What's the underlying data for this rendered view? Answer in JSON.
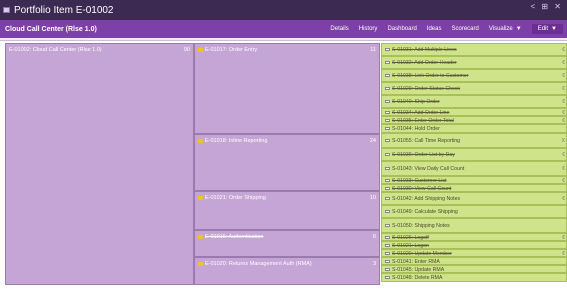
{
  "window": {
    "title": "Portfolio Item E-01002",
    "controls": "< ⊞ ✕"
  },
  "header": {
    "title": "Cloud Call Center (Rlse 1.0)",
    "menu": [
      "Details",
      "History",
      "Dashboard",
      "Ideas",
      "Scorecard"
    ],
    "visualize": "Visualize",
    "edit": "Edit"
  },
  "epic": {
    "label": "E-01002: Cloud Call Center (Rlse 1.0)",
    "count": "90"
  },
  "features": [
    {
      "label": "E-01017: Order Entry",
      "count": "11",
      "strike": false
    },
    {
      "label": "E-01018: Inline Reporting",
      "count": "24",
      "strike": false
    },
    {
      "label": "E-01021: Order Shipping",
      "count": "10",
      "strike": false
    },
    {
      "label": "E-01015: Authentication",
      "count": "6",
      "strike": true
    },
    {
      "label": "E-01020: Returns Management Auth (RMA)",
      "count": "3",
      "strike": false
    }
  ],
  "stories": [
    {
      "label": "S-01031: Add Multiple Lines",
      "done": true,
      "edge": "€"
    },
    {
      "label": "S-01032: Add Order Header",
      "done": true,
      "edge": "€"
    },
    {
      "label": "S-01038: Link Order to Customer",
      "done": true,
      "edge": "€"
    },
    {
      "label": "S-01029: Order Status Check",
      "done": true,
      "edge": "€"
    },
    {
      "label": "S-01040: Ship Order",
      "done": true,
      "edge": "€"
    },
    {
      "label": "S-01034: Add Order Line",
      "done": true,
      "edge": "€"
    },
    {
      "label": "S-01035: Enter Order Total",
      "done": true,
      "edge": "€"
    },
    {
      "label": "S-01044: Hold Order",
      "done": false,
      "edge": ""
    },
    {
      "label": "S-01055: Call Time Reporting",
      "done": false,
      "edge": "X"
    },
    {
      "label": "S-01036: Order List by Day",
      "done": true,
      "edge": "€"
    },
    {
      "label": "S-01043: View Daily Call Count",
      "done": false,
      "edge": "€"
    },
    {
      "label": "S-01033: Customer List",
      "done": true,
      "edge": "€"
    },
    {
      "label": "S-01030: View Call Count",
      "done": true,
      "edge": ""
    },
    {
      "label": "S-01042: Add Shipping Notes",
      "done": false,
      "edge": "€"
    },
    {
      "label": "S-01049: Calculate Shipping",
      "done": false,
      "edge": ""
    },
    {
      "label": "S-01050: Shipping Notes",
      "done": false,
      "edge": ""
    },
    {
      "label": "S-01026: Logoff",
      "done": true,
      "edge": "€"
    },
    {
      "label": "S-01021: Logon",
      "done": true,
      "edge": ""
    },
    {
      "label": "S-01020: Update Member",
      "done": true,
      "edge": "€"
    },
    {
      "label": "S-01041: Enter RMA",
      "done": false,
      "edge": ""
    },
    {
      "label": "S-01045: Update RMA",
      "done": false,
      "edge": ""
    },
    {
      "label": "S-01048: Delete RMA",
      "done": false,
      "edge": ""
    }
  ]
}
